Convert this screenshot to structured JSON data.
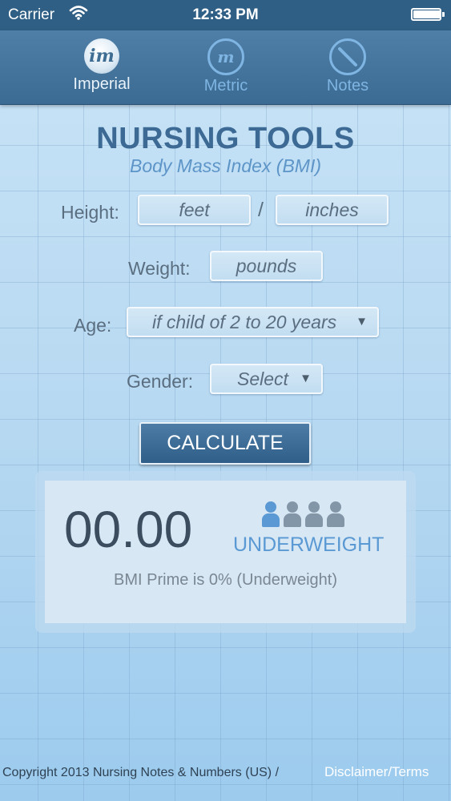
{
  "status_bar": {
    "carrier": "Carrier",
    "time": "12:33 PM",
    "wifi_icon": "wifi-icon",
    "battery_icon": "battery-icon",
    "battery_level": 1.0
  },
  "tabs": [
    {
      "label": "Imperial",
      "icon_text": "im",
      "icon": "imperial-icon",
      "selected": true
    },
    {
      "label": "Metric",
      "icon_text": "m",
      "icon": "metric-icon",
      "selected": false
    },
    {
      "label": "Notes",
      "icon_text": "",
      "icon": "pencil-icon",
      "selected": false
    }
  ],
  "header": {
    "title": "NURSING TOOLS",
    "subtitle": "Body Mass Index (BMI)"
  },
  "form": {
    "height_label": "Height:",
    "feet_placeholder": "feet",
    "separator": "/",
    "inches_placeholder": "inches",
    "weight_label": "Weight:",
    "pounds_placeholder": "pounds",
    "age_label": "Age:",
    "age_value": "if child of 2 to 20 years",
    "gender_label": "Gender:",
    "gender_value": "Select",
    "dropdown_icon": "triangle-down-icon",
    "calculate_label": "CALCULATE"
  },
  "result": {
    "bmi_value": "00.00",
    "category": "UNDERWEIGHT",
    "prime_text": "BMI Prime is 0%  (Underweight)",
    "person_icons": 4,
    "highlighted_person_index": 0,
    "colors": {
      "highlight": "#5a99d3",
      "inactive": "#8396a8"
    }
  },
  "footer": {
    "copyright": "Copyright 2013 Nursing Notes & Numbers (US) /",
    "disclaimer": "Disclaimer/Terms"
  },
  "colors": {
    "accent": "#3c6a94",
    "tab_bar": "#3b6b93",
    "button": "#2f5f88"
  }
}
